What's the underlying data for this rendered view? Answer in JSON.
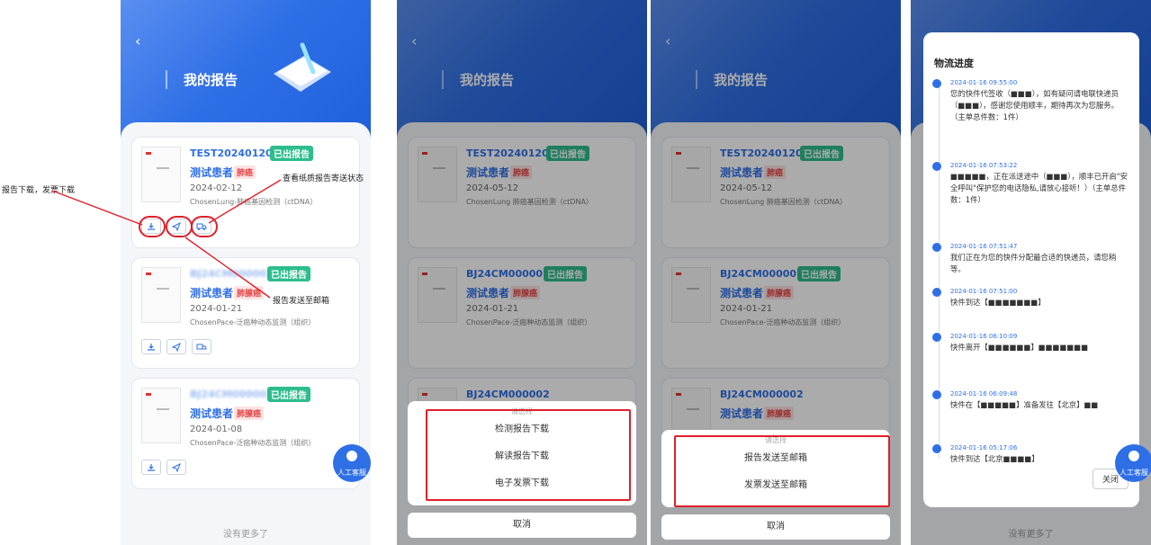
{
  "page_title": "我的报告",
  "back_icon": "‹",
  "reports": [
    {
      "id": "TEST202401201",
      "status": "已出报告",
      "patient": "测试患者",
      "tag": "肺癌",
      "date": "2024-02-12",
      "product": "ChosenLung-肺癌基因检测（ctDNA）"
    },
    {
      "id": "BJ24CM000002",
      "status": "已出报告",
      "patient": "测试患者",
      "tag": "肺腺癌",
      "date": "2024-01-21",
      "product": "ChosenPace-泛癌种动态监测（组织）"
    },
    {
      "id": "BJ24CM000002",
      "status": "已出报告",
      "patient": "测试患者",
      "tag": "肺腺癌",
      "date": "2024-01-08",
      "product": "ChosenPace-泛癌种动态监测（组织）"
    }
  ],
  "reports_blurred": [
    {
      "id": "TEST202401201",
      "status": "已出报告",
      "patient": "测试患者",
      "tag": "肺癌",
      "date": "2024-05-12",
      "product": "ChosenLung 肺癌基因检测（ctDNA）"
    },
    {
      "id": "BJ24CM000002",
      "status": "已出报告",
      "patient": "测试患者",
      "tag": "肺腺癌",
      "date": "2024-01-21",
      "product": "ChosenPace-泛癌种动态监测（组织）"
    },
    {
      "id": "BJ24CM000002",
      "status": "已出报告",
      "patient": "测试患者",
      "tag": "肺腺癌"
    }
  ],
  "no_more": "没有更多了",
  "customer_service": "人工客服",
  "annotations": {
    "download": "报告下载，发票下载",
    "paper_status": "查看纸质报告寄送状态",
    "send_email": "报告发送至邮箱"
  },
  "sheet_download": {
    "hint": "请选择",
    "options": [
      "检测报告下载",
      "解读报告下载",
      "电子发票下载"
    ],
    "cancel": "取消"
  },
  "sheet_email": {
    "hint": "请选择",
    "options": [
      "报告发送至邮箱",
      "发票发送至邮箱"
    ],
    "cancel": "取消"
  },
  "logistics": {
    "title": "物流进度",
    "events": [
      {
        "time": "2024-01-16 09:55:00",
        "text": "您的快件代签收（■■■），如有疑问请电联快递员（■■■），感谢您使用顺丰，期待再次为您服务。（主单总件数：1件）"
      },
      {
        "time": "2024-01-16 07:53:22",
        "text": "■■■■■，正在派送途中（■■■），顺丰已开启\"安全呼叫\"保护您的电话隐私,请放心接听！）（主单总件数：1件）"
      },
      {
        "time": "2024-01-16 07:51:47",
        "text": "我们正在为您的快件分配最合适的快递员，请您稍等。"
      },
      {
        "time": "2024-01-16 07:51:00",
        "text": "快件到达【■■■■■■■】"
      },
      {
        "time": "2024-01-16 06:10:09",
        "text": "快件离开【■■■■■■】■■■■■■■"
      },
      {
        "time": "2024-01-16 06:09:48",
        "text": "快件在【■■■■■】准备发往【北京】■■"
      },
      {
        "time": "2024-01-16 05:17:06",
        "text": "快件到达【北京■■■■】"
      }
    ],
    "close": "关闭"
  },
  "colors": {
    "primary": "#2f6fe6",
    "success": "#2dbd8c",
    "danger": "#e54545",
    "annotation": "#e0202a"
  }
}
